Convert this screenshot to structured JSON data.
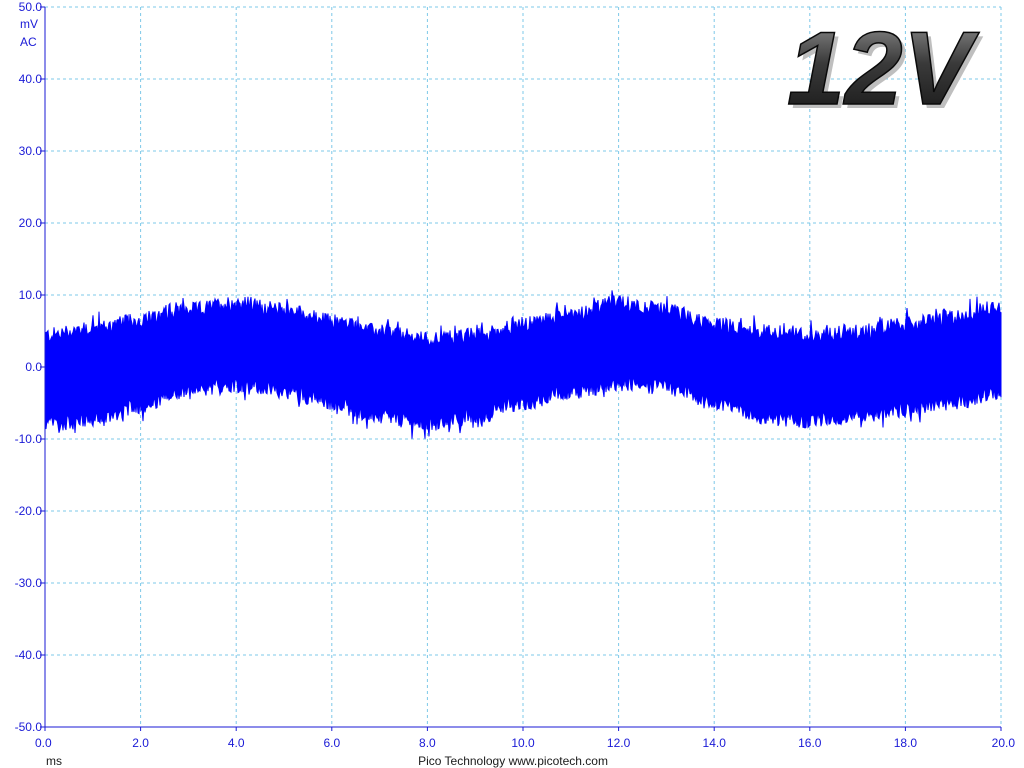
{
  "chart_data": {
    "type": "line",
    "title": "12V",
    "ylabel": "mV",
    "coupling": "AC",
    "xunit": "ms",
    "xlim": [
      0,
      20
    ],
    "ylim": [
      -50,
      50
    ],
    "x_ticks": [
      "0.0",
      "2.0",
      "4.0",
      "6.0",
      "8.0",
      "10.0",
      "12.0",
      "14.0",
      "16.0",
      "18.0",
      "20.0"
    ],
    "y_ticks": [
      "50.0",
      "40.0",
      "30.0",
      "20.0",
      "10.0",
      "0.0",
      "-10.0",
      "-20.0",
      "-30.0",
      "-40.0",
      "-50.0"
    ],
    "grid": true,
    "series": [
      {
        "color": "#0000ff",
        "x": [
          0,
          1,
          2,
          3,
          4,
          5,
          6,
          7,
          8,
          9,
          10,
          11,
          12,
          13,
          14,
          15,
          16,
          17,
          18,
          19,
          20
        ],
        "upper": [
          4.5,
          5.5,
          6.5,
          8.0,
          9.0,
          8.0,
          6.5,
          5.0,
          4.0,
          4.5,
          6.0,
          7.5,
          9.0,
          8.0,
          6.0,
          5.0,
          4.5,
          5.0,
          6.0,
          7.0,
          8.5
        ],
        "lower": [
          -8.0,
          -7.5,
          -5.5,
          -3.5,
          -2.5,
          -3.5,
          -5.0,
          -7.0,
          -8.0,
          -7.0,
          -5.0,
          -3.5,
          -2.5,
          -3.0,
          -5.0,
          -7.0,
          -7.5,
          -7.0,
          -6.0,
          -5.0,
          -3.5
        ]
      }
    ]
  },
  "footer": "Pico Technology  www.picotech.com"
}
